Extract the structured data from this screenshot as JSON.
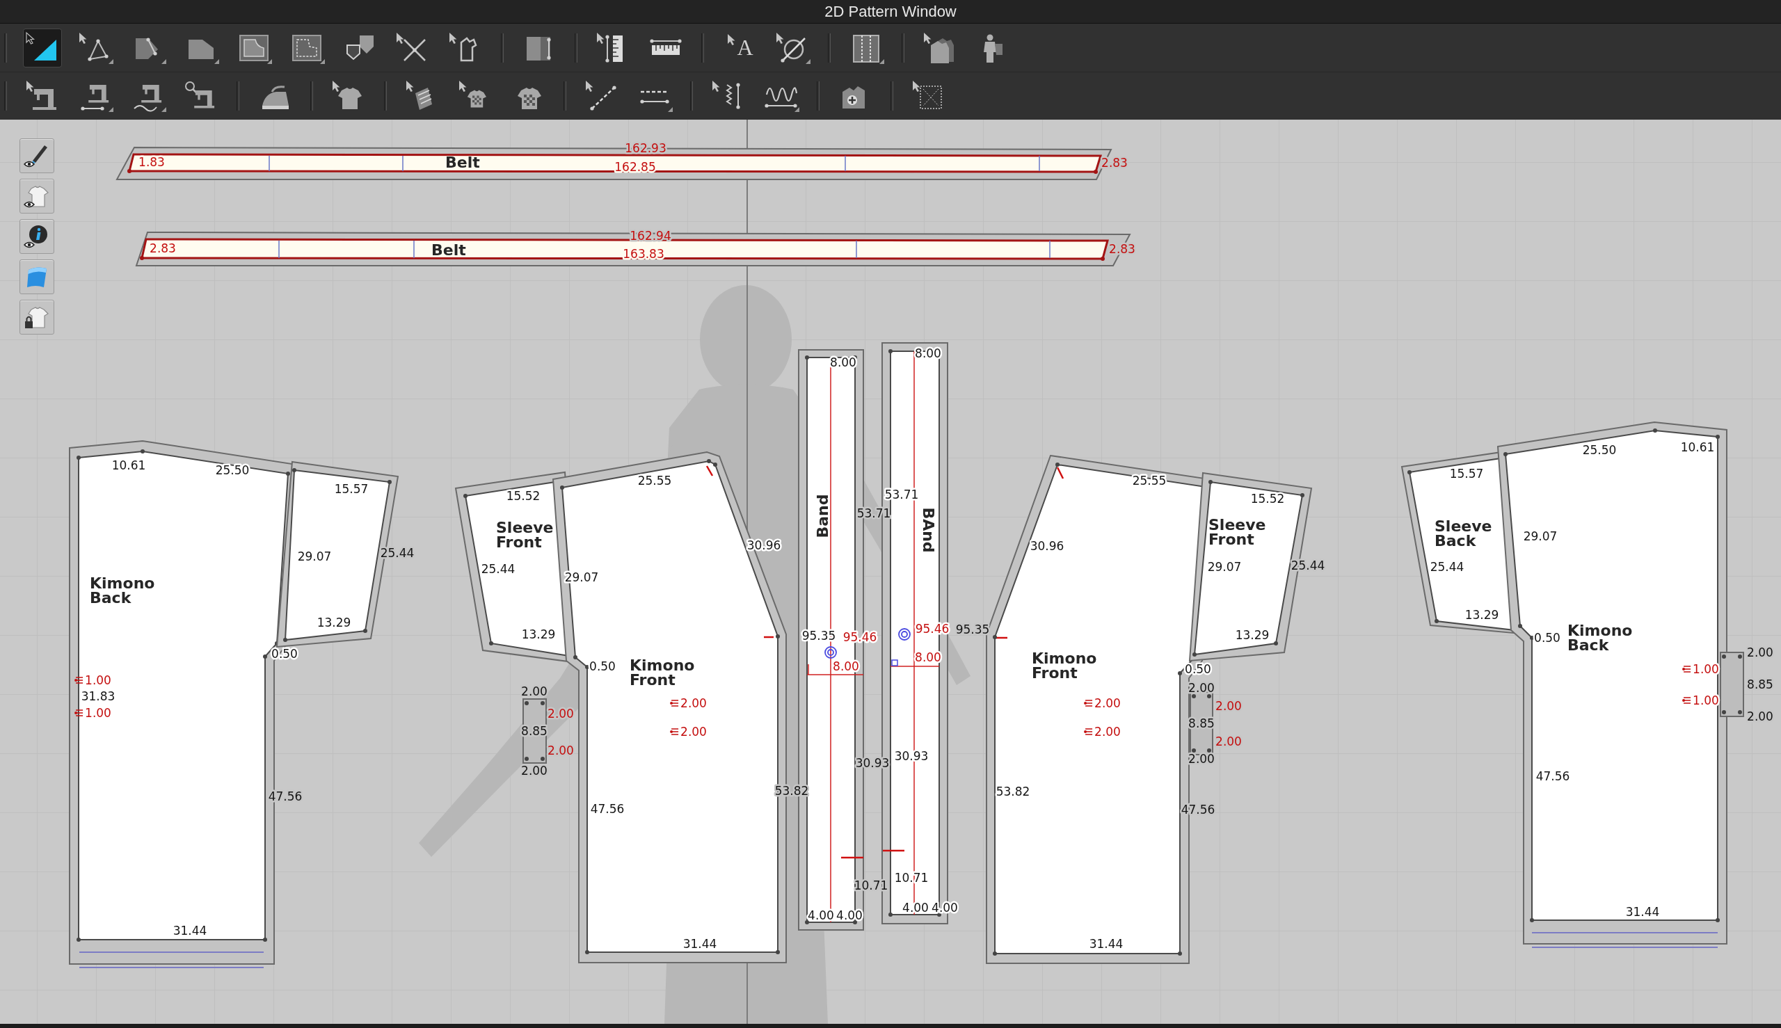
{
  "window": {
    "title": "2D Pattern Window"
  },
  "toolbar": {
    "rows": [
      {
        "groups": [
          [
            {
              "selected": true,
              "submenu": false
            },
            {
              "selected": false,
              "submenu": true
            },
            {
              "selected": false,
              "submenu": true
            },
            {
              "selected": false,
              "submenu": true
            },
            {
              "selected": false,
              "submenu": true
            },
            {
              "selected": false,
              "submenu": true
            },
            {
              "selected": false,
              "submenu": false
            },
            {
              "selected": false,
              "submenu": false
            },
            {
              "selected": false,
              "submenu": false
            }
          ],
          [
            {
              "selected": false,
              "submenu": false
            }
          ],
          [
            {
              "selected": false,
              "submenu": false
            },
            {
              "selected": false,
              "submenu": false
            }
          ],
          [
            {
              "selected": false,
              "submenu": false,
              "glyph": "A"
            },
            {
              "selected": false,
              "submenu": true
            }
          ],
          [
            {
              "selected": false,
              "submenu": true
            }
          ],
          [
            {
              "selected": false,
              "submenu": false
            },
            {
              "selected": false,
              "submenu": false
            }
          ]
        ]
      },
      {
        "groups": [
          [
            {
              "selected": false,
              "submenu": false
            },
            {
              "selected": false,
              "submenu": true
            },
            {
              "selected": false,
              "submenu": true
            },
            {
              "selected": false,
              "submenu": false
            }
          ],
          [
            {
              "selected": false,
              "submenu": false
            }
          ],
          [
            {
              "selected": false,
              "submenu": false
            }
          ],
          [
            {
              "selected": false,
              "submenu": false
            },
            {
              "selected": false,
              "submenu": false
            },
            {
              "selected": false,
              "submenu": false
            }
          ],
          [
            {
              "selected": false,
              "submenu": false
            },
            {
              "selected": false,
              "submenu": true
            }
          ],
          [
            {
              "selected": false,
              "submenu": false
            },
            {
              "selected": false,
              "submenu": true
            }
          ],
          [
            {
              "selected": false,
              "submenu": false
            }
          ],
          [
            {
              "selected": false,
              "submenu": false
            }
          ]
        ]
      }
    ]
  },
  "side_toolbar": [
    {
      "selected": false
    },
    {
      "selected": false
    },
    {
      "selected": false
    },
    {
      "selected": false
    },
    {
      "selected": false
    }
  ],
  "canvas": {
    "pieces": [
      {
        "kind": "belt",
        "label": "Belt",
        "marks": [
          {
            "text": "1.83"
          },
          {
            "text": "162.93"
          },
          {
            "text": "162.85"
          },
          {
            "text": "2.83"
          }
        ]
      },
      {
        "kind": "belt",
        "label": "Belt",
        "marks": [
          {
            "text": "2.83"
          },
          {
            "text": "162.94"
          },
          {
            "text": "163.83"
          },
          {
            "text": "2.83"
          }
        ]
      },
      {
        "kind": "body",
        "label": "Kimono Back",
        "measurements": [
          "10.61",
          "25.50",
          "47.56",
          "31.44",
          "0.50",
          "31.83"
        ],
        "marks": [
          {
            "text": "1.00",
            "marker": true
          },
          {
            "text": "1.00",
            "marker": true
          }
        ]
      },
      {
        "kind": "sleeve",
        "measurements": [
          "15.57",
          "29.07",
          "25.44",
          "13.29"
        ]
      },
      {
        "kind": "sleeve",
        "label": "Sleeve Front",
        "measurements": [
          "15.52",
          "25.44",
          "29.07",
          "13.29"
        ]
      },
      {
        "kind": "tab",
        "measurements": [
          "2.00",
          "8.85",
          "2.00"
        ],
        "marks": [
          {
            "text": "2.00"
          },
          {
            "text": "2.00"
          }
        ]
      },
      {
        "kind": "body",
        "label": "Kimono Front",
        "measurements": [
          "25.55",
          "30.96",
          "53.82",
          "47.56",
          "31.44",
          "0.50"
        ],
        "marks": [
          {
            "text": "2.00",
            "marker": true
          },
          {
            "text": "2.00",
            "marker": true
          }
        ]
      },
      {
        "kind": "band",
        "label": "Band",
        "measurements": [
          "8.00",
          "53.71",
          "95.35",
          "30.93",
          "10.71",
          "4.00",
          "4.00"
        ],
        "marks": [
          {
            "text": "95.46"
          },
          {
            "text": "8.00"
          }
        ]
      },
      {
        "kind": "band",
        "label": "BAnd",
        "measurements": [
          "8.00",
          "53.71",
          "95.35",
          "30.93",
          "10.71",
          "4.00",
          "4.00"
        ],
        "marks": [
          {
            "text": "95.46"
          },
          {
            "text": "8.00"
          }
        ]
      },
      {
        "kind": "body",
        "label": "Kimono Front",
        "measurements": [
          "25.55",
          "30.96",
          "53.82",
          "47.56",
          "31.44",
          "0.50"
        ],
        "marks": [
          {
            "text": "2.00",
            "marker": true
          },
          {
            "text": "2.00",
            "marker": true
          }
        ]
      },
      {
        "kind": "sleeve",
        "label": "Sleeve Front",
        "measurements": [
          "15.52",
          "29.07",
          "25.44",
          "13.29"
        ]
      },
      {
        "kind": "tab",
        "measurements": [
          "2.00",
          "8.85",
          "2.00"
        ],
        "marks": [
          {
            "text": "2.00"
          },
          {
            "text": "2.00"
          }
        ]
      },
      {
        "kind": "sleeve",
        "label": "Sleeve Back",
        "measurements": [
          "15.57",
          "25.44",
          "13.29"
        ]
      },
      {
        "kind": "body",
        "label": "Kimono Back",
        "measurements": [
          "25.50",
          "10.61",
          "29.07",
          "0.50",
          "47.56",
          "31.44"
        ]
      },
      {
        "kind": "tab",
        "measurements": [
          "2.00",
          "8.85",
          "2.00"
        ],
        "marks": [
          {
            "text": "1.00",
            "marker": true
          },
          {
            "text": "1.00",
            "marker": true
          }
        ]
      }
    ]
  }
}
